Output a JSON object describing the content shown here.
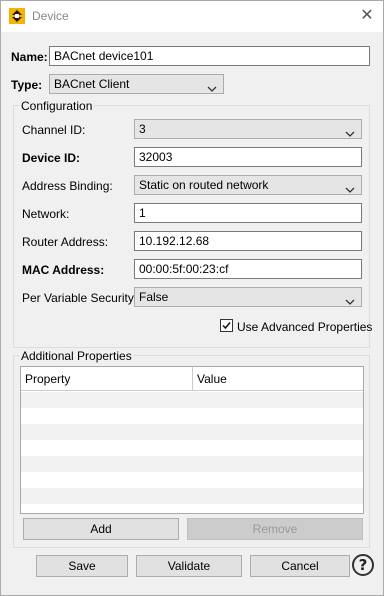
{
  "window": {
    "title": "Device"
  },
  "icons": {
    "app": "up-down-arrows-icon",
    "close": "close-icon",
    "chevron": "chevron-down-icon",
    "help": "help-icon",
    "check": "checkmark-icon"
  },
  "form": {
    "name_label": "Name:",
    "name_value": "BACnet device101",
    "type_label": "Type:",
    "type_value": "BACnet Client"
  },
  "configuration": {
    "title": "Configuration",
    "channel_label": "Channel ID:",
    "channel_value": "3",
    "device_id_label": "Device ID:",
    "device_id_value": "32003",
    "address_binding_label": "Address Binding:",
    "address_binding_value": "Static on routed network",
    "network_label": "Network:",
    "network_value": "1",
    "router_label": "Router Address:",
    "router_value": "10.192.12.68",
    "mac_label": "MAC Address:",
    "mac_value": "00:00:5f:00:23:cf",
    "security_label": "Per Variable Security:",
    "security_value": "False",
    "advanced_label": "Use Advanced Properties",
    "advanced_checked": true
  },
  "additional": {
    "title": "Additional Properties",
    "columns": [
      "Property",
      "Value"
    ],
    "add_label": "Add",
    "remove_label": "Remove"
  },
  "footer": {
    "save_label": "Save",
    "validate_label": "Validate",
    "cancel_label": "Cancel",
    "help_label": "?"
  }
}
